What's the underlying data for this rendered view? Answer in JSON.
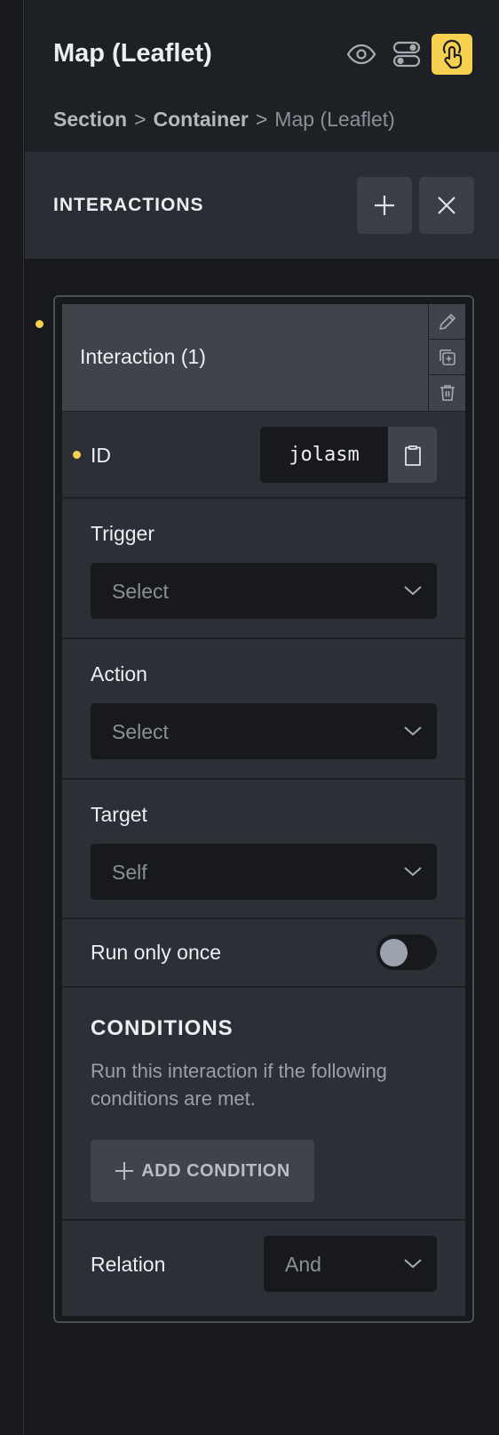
{
  "header": {
    "title": "Map (Leaflet)",
    "icons": [
      "eye-icon",
      "toggle-icon",
      "interactions-icon"
    ]
  },
  "breadcrumb": {
    "items": [
      "Section",
      "Container",
      "Map (Leaflet)"
    ],
    "separator": ">"
  },
  "interactions": {
    "title": "INTERACTIONS"
  },
  "item": {
    "title": "Interaction (1)",
    "id_label": "ID",
    "id_value": "jolasm",
    "trigger_label": "Trigger",
    "trigger_value": "Select",
    "action_label": "Action",
    "action_value": "Select",
    "target_label": "Target",
    "target_value": "Self",
    "run_once_label": "Run only once",
    "run_once_on": false
  },
  "conditions": {
    "title": "CONDITIONS",
    "description": "Run this interaction if the following conditions are met.",
    "add_label": "ADD CONDITION"
  },
  "relation": {
    "label": "Relation",
    "value": "And"
  },
  "colors": {
    "accent": "#f6d14f",
    "background": "#17191c",
    "panel": "#2b2f36"
  }
}
